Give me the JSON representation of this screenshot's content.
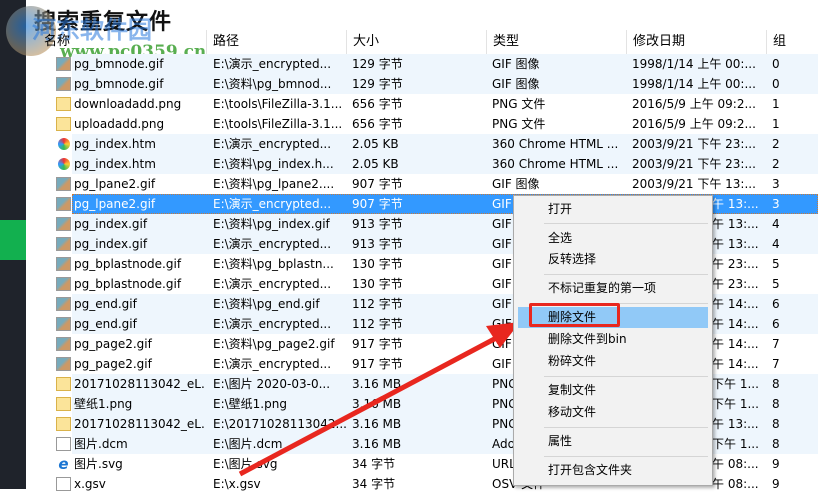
{
  "title": "搜索重复文件",
  "watermark": {
    "site_name": "河东软件园",
    "url": "www.pc0359.cn"
  },
  "columns": [
    "名称",
    "路径",
    "大小",
    "类型",
    "修改日期",
    "组"
  ],
  "rows": [
    {
      "icon": "gif",
      "name": "pg_bmnode.gif",
      "path": "E:\\演示_encrypted...",
      "size": "129 字节",
      "type": "GIF 图像",
      "date": "1998/1/14 上午 00:...",
      "group": "0"
    },
    {
      "icon": "gif",
      "name": "pg_bmnode.gif",
      "path": "E:\\资料\\pg_bmnod...",
      "size": "129 字节",
      "type": "GIF 图像",
      "date": "1998/1/14 上午 00:...",
      "group": "0"
    },
    {
      "icon": "png",
      "name": "downloadadd.png",
      "path": "E:\\tools\\FileZilla-3.1...",
      "size": "656 字节",
      "type": "PNG 文件",
      "date": "2016/5/9 上午 09:2...",
      "group": "1"
    },
    {
      "icon": "png",
      "name": "uploadadd.png",
      "path": "E:\\tools\\FileZilla-3.1...",
      "size": "656 字节",
      "type": "PNG 文件",
      "date": "2016/5/9 上午 09:2...",
      "group": "1"
    },
    {
      "icon": "htm",
      "name": "pg_index.htm",
      "path": "E:\\演示_encrypted...",
      "size": "2.05 KB",
      "type": "360 Chrome HTML ...",
      "date": "2003/9/21 下午 23:...",
      "group": "2"
    },
    {
      "icon": "htm",
      "name": "pg_index.htm",
      "path": "E:\\资料\\pg_index.h...",
      "size": "2.05 KB",
      "type": "360 Chrome HTML ...",
      "date": "2003/9/21 下午 23:...",
      "group": "2"
    },
    {
      "icon": "gif",
      "name": "pg_lpane2.gif",
      "path": "E:\\资料\\pg_lpane2....",
      "size": "907 字节",
      "type": "GIF 图像",
      "date": "2003/9/21 下午 13:...",
      "group": "3"
    },
    {
      "icon": "gif",
      "name": "pg_lpane2.gif",
      "path": "E:\\演示_encrypted...",
      "size": "907 字节",
      "type": "GIF",
      "date_tail": "午 13:...",
      "group": "3",
      "selected": true
    },
    {
      "icon": "gif",
      "name": "pg_index.gif",
      "path": "E:\\资料\\pg_index.gif",
      "size": "913 字节",
      "type": "GIF",
      "date_tail": "午 13:...",
      "group": "4"
    },
    {
      "icon": "gif",
      "name": "pg_index.gif",
      "path": "E:\\演示_encrypted...",
      "size": "913 字节",
      "type": "GIF",
      "date_tail": "午 13:...",
      "group": "4"
    },
    {
      "icon": "gif",
      "name": "pg_bplastnode.gif",
      "path": "E:\\资料\\pg_bplastn...",
      "size": "130 字节",
      "type": "GIF",
      "date_tail": "午 23:...",
      "group": "5"
    },
    {
      "icon": "gif",
      "name": "pg_bplastnode.gif",
      "path": "E:\\演示_encrypted...",
      "size": "130 字节",
      "type": "GIF",
      "date_tail": "午 23:...",
      "group": "5"
    },
    {
      "icon": "gif",
      "name": "pg_end.gif",
      "path": "E:\\资料\\pg_end.gif",
      "size": "112 字节",
      "type": "GIF",
      "date_tail": "午 14:...",
      "group": "6"
    },
    {
      "icon": "gif",
      "name": "pg_end.gif",
      "path": "E:\\演示_encrypted...",
      "size": "112 字节",
      "type": "GIF",
      "date_tail": "午 14:...",
      "group": "6"
    },
    {
      "icon": "gif",
      "name": "pg_page2.gif",
      "path": "E:\\资料\\pg_page2.gif",
      "size": "917 字节",
      "type": "GIF",
      "date_tail": "午 14:...",
      "group": "7"
    },
    {
      "icon": "gif",
      "name": "pg_page2.gif",
      "path": "E:\\演示_encrypted...",
      "size": "917 字节",
      "type": "GIF",
      "date_tail": "午 14:...",
      "group": "7"
    },
    {
      "icon": "png",
      "name": "20171028113042_eL...",
      "path": "E:\\图片 2020-03-0...",
      "size": "3.16 MB",
      "type": "PNG",
      "date_tail": "下午 1...",
      "group": "8"
    },
    {
      "icon": "png",
      "name": "壁纸1.png",
      "path": "E:\\壁纸1.png",
      "size": "3.16 MB",
      "type": "PNG",
      "date_tail": "下午 1...",
      "group": "8"
    },
    {
      "icon": "png",
      "name": "20171028113042_eL...",
      "path": "E:\\20171028113042...",
      "size": "3.16 MB",
      "type": "PNG",
      "date_tail": "午 13:...",
      "group": "8"
    },
    {
      "icon": "file",
      "name": "图片.dcm",
      "path": "E:\\图片.dcm",
      "size": "3.16 MB",
      "type": "Ado",
      "date_tail": "下午 1...",
      "group": "8"
    },
    {
      "icon": "svg",
      "name": "图片.svg",
      "path": "E:\\图片.svg",
      "size": "34 字节",
      "type": "URL",
      "date_tail": "午 08:...",
      "group": "9"
    },
    {
      "icon": "file",
      "name": "x.gsv",
      "path": "E:\\x.gsv",
      "size": "34 字节",
      "type": "OSV 文件",
      "date_tail": "午 08:...",
      "group": "9"
    }
  ],
  "context_menu": {
    "items": [
      "打开",
      "全选",
      "反转选择",
      "不标记重复的第一项",
      "删除文件",
      "删除文件到bin",
      "粉碎文件",
      "复制文件",
      "移动文件",
      "属性",
      "打开包含文件夹"
    ],
    "highlighted": "删除文件"
  },
  "colors": {
    "selection": "#3399ff",
    "group_stripe": "#eef6fd",
    "menu_highlight": "#91c9f7",
    "annotation": "#e8271f",
    "sidebar_accent": "#12b04f"
  }
}
